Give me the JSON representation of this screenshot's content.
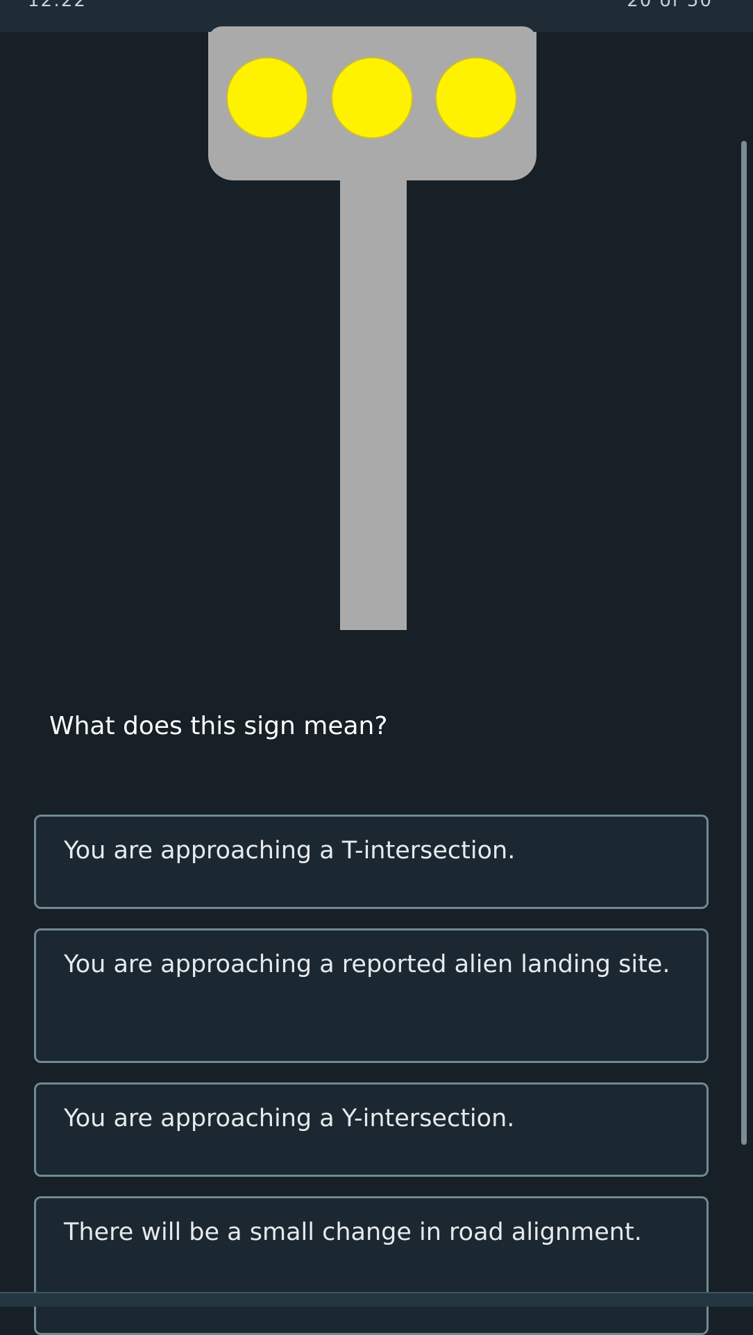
{
  "status_bar": {
    "time": "12:22",
    "progress": "20 of 50"
  },
  "sign": {
    "light_color": "#fff200",
    "body_color": "#aaaaaa"
  },
  "question": "What does this sign mean?",
  "options": [
    "You are approaching a T-intersection.",
    "You are approaching a reported alien landing site.",
    "You are approaching a Y-intersection.",
    "There will be a small change in road alignment."
  ]
}
